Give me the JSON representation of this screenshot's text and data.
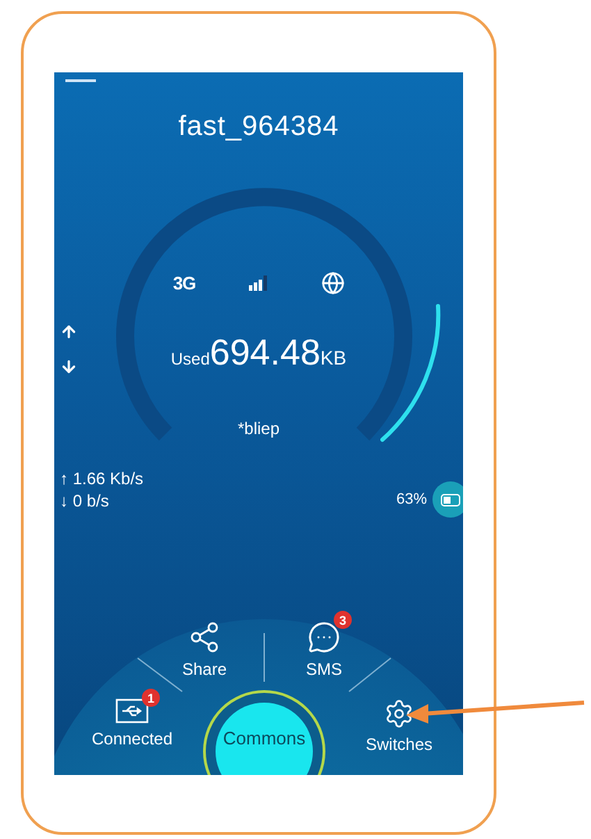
{
  "title": "fast_964384",
  "status_icons": {
    "network": "3G"
  },
  "usage": {
    "label": "Used",
    "value": "694.48",
    "unit": "KB"
  },
  "operator": "*bliep",
  "speeds": [
    "↑ 1.66 Kb/s",
    "↓ 0 b/s"
  ],
  "battery": {
    "text": "63%"
  },
  "menu": [
    {
      "kind": "usb",
      "label": "Connected",
      "badge": "1"
    },
    {
      "kind": "share",
      "label": "Share"
    },
    {
      "kind": "message",
      "label": "SMS",
      "badge": "3"
    },
    {
      "kind": "gear",
      "label": "Switches"
    }
  ],
  "center_button": "Commons"
}
